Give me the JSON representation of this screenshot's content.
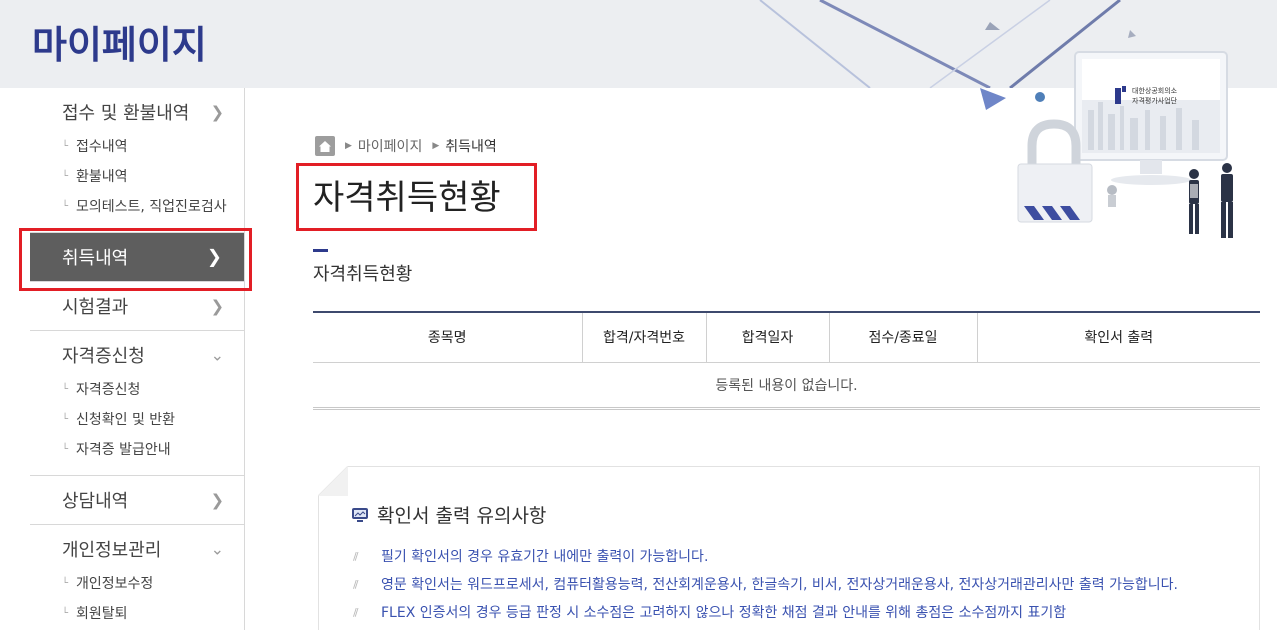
{
  "header": {
    "title": "마이페이지"
  },
  "sidebar": {
    "groups": [
      {
        "label": "접수 및 환불내역",
        "arrow": "right",
        "items": [
          "접수내역",
          "환불내역",
          "모의테스트, 직업진로검사"
        ]
      },
      {
        "label": "취득내역",
        "arrow": "right",
        "active": true,
        "items": []
      },
      {
        "label": "시험결과",
        "arrow": "right",
        "items": []
      },
      {
        "label": "자격증신청",
        "arrow": "down",
        "items": [
          "자격증신청",
          "신청확인 및 반환",
          "자격증 발급안내"
        ]
      },
      {
        "label": "상담내역",
        "arrow": "right",
        "items": []
      },
      {
        "label": "개인정보관리",
        "arrow": "down",
        "items": [
          "개인정보수정",
          "회원탈퇴"
        ]
      }
    ]
  },
  "breadcrumb": {
    "items": [
      "마이페이지",
      "취득내역"
    ]
  },
  "main": {
    "title": "자격취득현황",
    "section_title": "자격취득현황"
  },
  "table": {
    "headers": [
      "종목명",
      "합격/자격번호",
      "합격일자",
      "점수/종료일",
      "확인서 출력"
    ],
    "empty_message": "등록된 내용이 없습니다."
  },
  "notice": {
    "title": "확인서 출력 유의사항",
    "items": [
      "필기 확인서의 경우 유효기간 내에만 출력이 가능합니다.",
      "영문 확인서는 워드프로세서, 컴퓨터활용능력, 전산회계운용사, 한글속기, 비서, 전자상거래운용사, 전자상거래관리사만 출력 가능합니다.",
      "FLEX 인증서의 경우 등급 판정 시 소수점은 고려하지 않으나 정확한 채점 결과 안내를 위해 총점은 소수점까지 표기함"
    ]
  },
  "illustration": {
    "monitor_text_1": "대한상공회의소",
    "monitor_text_2": "자격평가사업단"
  },
  "colors": {
    "brand": "#2d3a8c",
    "active_bg": "#5e5e5e",
    "highlight": "#e21e25",
    "notice_text": "#3a52b0"
  },
  "icons": {
    "home": "home-icon",
    "arrow_right": "chevron-right-icon",
    "arrow_down": "chevron-down-icon",
    "notice": "monitor-icon"
  }
}
